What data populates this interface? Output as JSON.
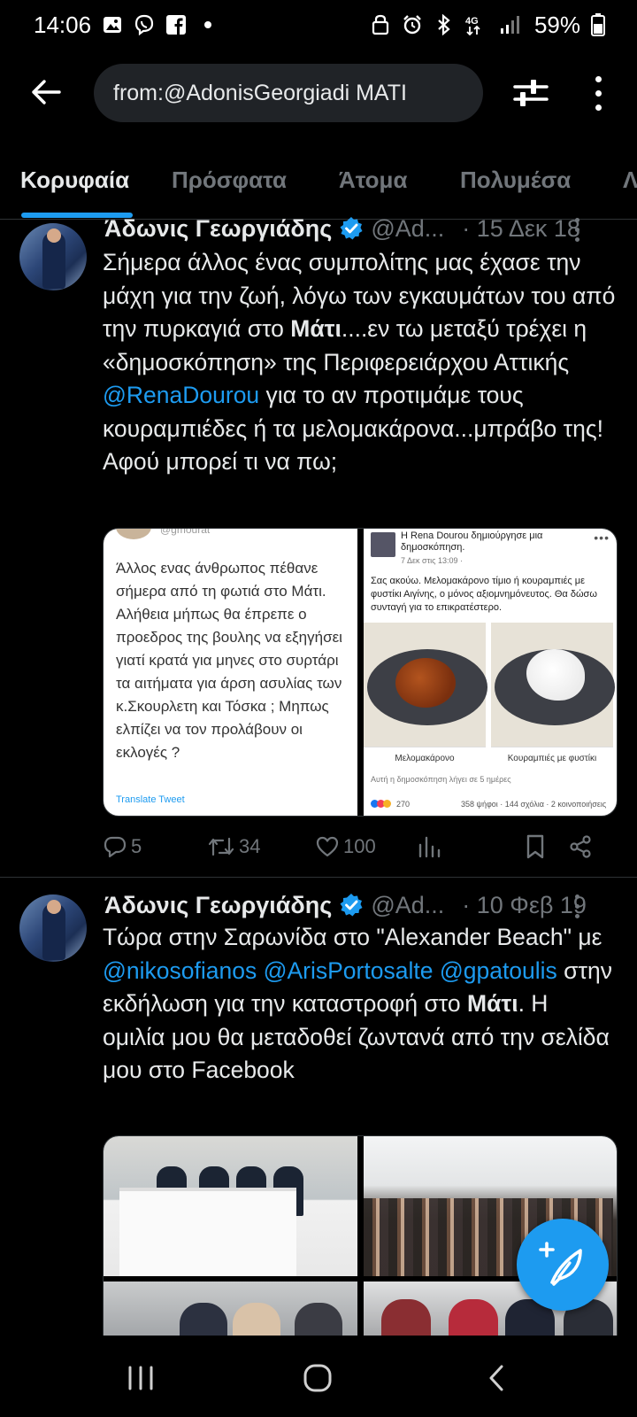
{
  "status_bar": {
    "time": "14:06",
    "battery": "59%",
    "network": "4G"
  },
  "search": {
    "query": "from:@AdonisGeorgiadi ΜΑΤΙ"
  },
  "tabs": [
    {
      "label": "Κορυφαία",
      "active": true
    },
    {
      "label": "Πρόσφατα",
      "active": false
    },
    {
      "label": "Άτομα",
      "active": false
    },
    {
      "label": "Πολυμέσα",
      "active": false
    },
    {
      "label": "Λ",
      "active": false
    }
  ],
  "tweets": [
    {
      "author": "Άδωνις Γεωργιάδης",
      "handle": "@Ad...",
      "date": "· 15 Δεκ 18",
      "text": {
        "p1": "Σήμερα άλλος ένας συμπολίτης μας έχασε την μάχη για την ζωή, λόγω των εγκαυμάτων του από την πυρκαγιά στο ",
        "bold1": "Μάτι",
        "p2": "....εν τω μεταξύ τρέχει η «δημοσκόπηση» της Περιφερειάρχου Αττικής ",
        "mention1": "@RenaDourou",
        "p3": " για το αν προτιμάμε τους κουραμπιέδες ή τα μελομακάρονα...μπράβο της! Αφού μπορεί τι να πω;"
      },
      "media": {
        "left": {
          "top_handle": "@gmourat",
          "text": "Άλλος ενας άνθρωπος πέθανε σήμερα από τη φωτιά στο Μάτι. Αλήθεια μήπως θα έπρεπε ο προεδρος της βουλης να εξηγήσει γιατί κρατά για μηνες στο συρτάρι τα αιτήματα για άρση ασυλίας των κ.Σκουρλετη και Τόσκα ; Μηπως ελπίζει να τον προλάβουν οι εκλογές ?",
          "translate": "Translate Tweet"
        },
        "right": {
          "title": "Η Rena Dourou δημιούργησε μια δημοσκόπηση.",
          "date": "7 Δεκ στις 13:09 · ",
          "text": "Σας ακούω. Μελομακάρονο τίμιο ή κουραμπιές με φυστίκι Αιγίνης, ο μόνος αξιομνημόνευτος. Θα δώσω συνταγή για το επικρατέστερο.",
          "option1": "Μελομακάρονο",
          "option2": "Κουραμπιές με φυστίκι",
          "footer": "Αυτή η δημοσκόπηση λήγει σε 5 ημέρες",
          "reactions": "270",
          "votes": "358 ψήφοι · 144 σχόλια · 2 κοινοποιήσεις"
        }
      },
      "replies": "5",
      "retweets": "34",
      "likes": "100"
    },
    {
      "author": "Άδωνις Γεωργιάδης",
      "handle": "@Ad...",
      "date": "· 10 Φεβ 19",
      "text": {
        "p1": "Τώρα στην Σαρωνίδα στο \"Alexander Beach\" με ",
        "mention1": "@nikosofianos",
        "mention2": "@ArisPortosalte",
        "mention3": "@gpatoulis",
        "p2": " στην εκδήλωση για την καταστροφή στο ",
        "bold1": "Μάτι",
        "p3": ". Η ομιλία μου θα μεταδοθεί ζωντανά από την  σελίδα μου στο Facebook"
      }
    }
  ],
  "colors": {
    "background": "#000000",
    "accent": "#1d9bf0",
    "muted": "#71767b",
    "text": "#e7e9ea"
  },
  "icons": {
    "back": "arrow-left-icon",
    "filter": "sliders-icon",
    "more": "vertical-dots-icon",
    "verified": "verified-badge-icon",
    "reply": "speech-bubble-icon",
    "retweet": "retweet-icon",
    "like": "heart-icon",
    "views": "bar-chart-icon",
    "bookmark": "bookmark-icon",
    "share": "share-icon",
    "compose": "feather-plus-icon"
  }
}
